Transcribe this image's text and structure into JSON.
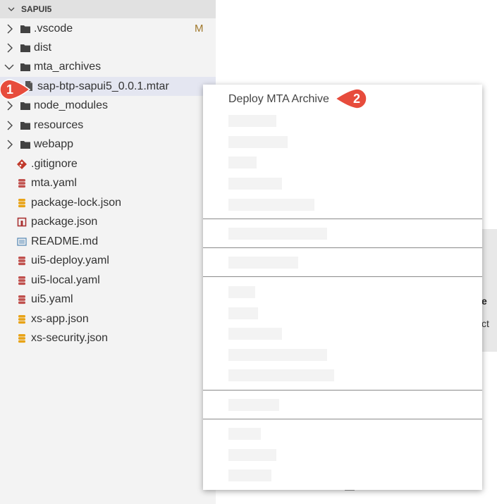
{
  "explorer": {
    "title": "SAPUI5",
    "items": [
      {
        "label": ".vscode",
        "icon": "folder-icon",
        "twisty": "closed",
        "badge": "M"
      },
      {
        "label": "dist",
        "icon": "folder-icon",
        "twisty": "closed"
      },
      {
        "label": "mta_archives",
        "icon": "folder-icon",
        "twisty": "open"
      },
      {
        "label": "sap-btp-sapui5_0.0.1.mtar",
        "icon": "file-icon",
        "selected": true
      },
      {
        "label": "node_modules",
        "icon": "folder-icon",
        "twisty": "closed"
      },
      {
        "label": "resources",
        "icon": "folder-icon",
        "twisty": "closed"
      },
      {
        "label": "webapp",
        "icon": "folder-icon",
        "twisty": "closed"
      },
      {
        "label": ".gitignore",
        "icon": "git-icon"
      },
      {
        "label": "mta.yaml",
        "icon": "yaml-icon"
      },
      {
        "label": "package-lock.json",
        "icon": "json-icon"
      },
      {
        "label": "package.json",
        "icon": "npm-icon"
      },
      {
        "label": "README.md",
        "icon": "markdown-icon"
      },
      {
        "label": "ui5-deploy.yaml",
        "icon": "yaml-icon"
      },
      {
        "label": "ui5-local.yaml",
        "icon": "yaml-icon"
      },
      {
        "label": "ui5.yaml",
        "icon": "yaml-icon"
      },
      {
        "label": "xs-app.json",
        "icon": "json-icon"
      },
      {
        "label": "xs-security.json",
        "icon": "json-icon"
      }
    ]
  },
  "context_menu": {
    "first_item": "Deploy MTA Archive"
  },
  "background": {
    "text_1": "e",
    "text_2": "ct"
  },
  "callouts": {
    "one": "1",
    "two": "2"
  },
  "colors": {
    "callout": "#e74c3c",
    "selected_row": "#e4e6f1",
    "folder": "#424242",
    "yaml": "#c0504d",
    "json": "#e8a317",
    "git": "#c0392b"
  }
}
